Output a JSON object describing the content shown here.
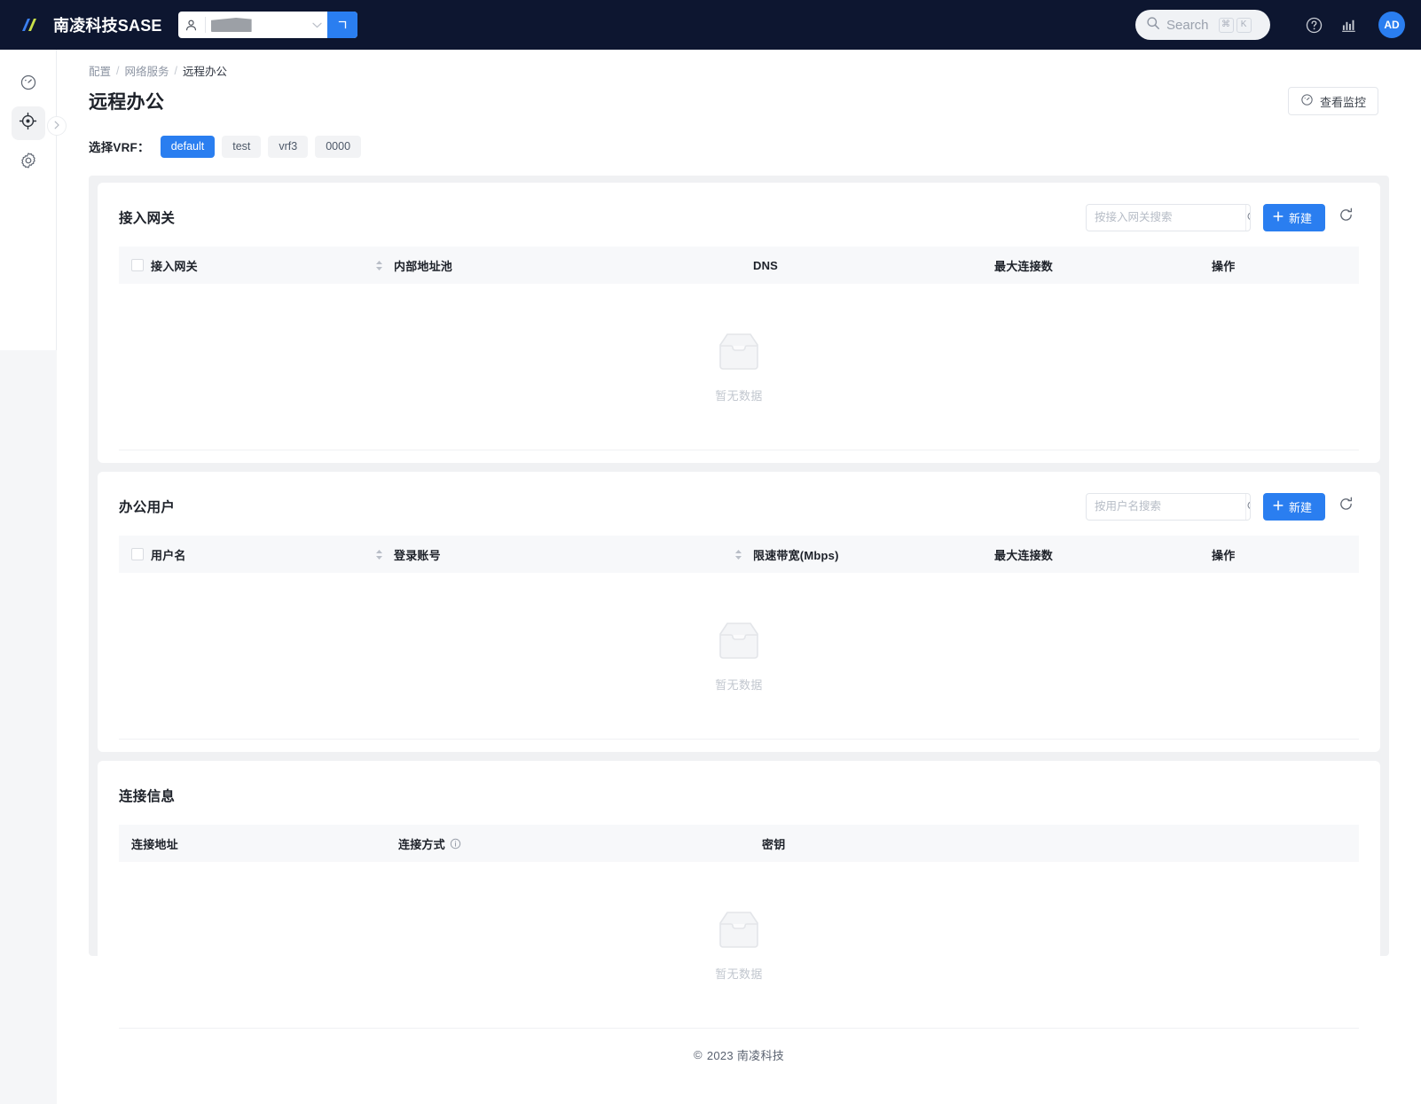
{
  "topbar": {
    "brand": "南凌科技SASE",
    "tenant_caret": "chevron-down",
    "search_placeholder": "Search",
    "search_key_cmd": "⌘",
    "search_key_letter": "K",
    "avatar_initials": "AD"
  },
  "sidebar": {
    "items": [
      {
        "name": "dashboard",
        "icon": "gauge-icon",
        "active": false
      },
      {
        "name": "network",
        "icon": "target-icon",
        "active": true
      },
      {
        "name": "settings",
        "icon": "gear-icon",
        "active": false
      }
    ]
  },
  "breadcrumb": {
    "items": [
      "配置",
      "网络服务",
      "远程办公"
    ],
    "separator": "/"
  },
  "page": {
    "title": "远程办公",
    "monitor_button": "查看监控"
  },
  "vrf": {
    "label": "选择VRF：",
    "options": [
      "default",
      "test",
      "vrf3",
      "0000"
    ],
    "selected": "default"
  },
  "cards": [
    {
      "title": "接入网关",
      "search_placeholder": "按接入网关搜索",
      "new_label": "新建",
      "columns": [
        {
          "label": "接入网关",
          "checkbox": true,
          "sortable": true
        },
        {
          "label": "内部地址池",
          "checkbox": false,
          "sortable": false
        },
        {
          "label": "DNS",
          "checkbox": false,
          "sortable": false
        },
        {
          "label": "最大连接数",
          "checkbox": false,
          "sortable": false
        },
        {
          "label": "操作",
          "checkbox": false,
          "sortable": false
        }
      ],
      "rows": [],
      "empty_text": "暂无数据"
    },
    {
      "title": "办公用户",
      "search_placeholder": "按用户名搜索",
      "new_label": "新建",
      "columns": [
        {
          "label": "用户名",
          "checkbox": true,
          "sortable": true
        },
        {
          "label": "登录账号",
          "checkbox": false,
          "sortable": true
        },
        {
          "label": "限速带宽(Mbps)",
          "checkbox": false,
          "sortable": false
        },
        {
          "label": "最大连接数",
          "checkbox": false,
          "sortable": false
        },
        {
          "label": "操作",
          "checkbox": false,
          "sortable": false
        }
      ],
      "rows": [],
      "empty_text": "暂无数据"
    },
    {
      "title": "连接信息",
      "search_placeholder": null,
      "new_label": null,
      "columns": [
        {
          "label": "连接地址",
          "checkbox": false,
          "sortable": false
        },
        {
          "label": "连接方式",
          "checkbox": false,
          "sortable": false,
          "info": true
        },
        {
          "label": "密钥",
          "checkbox": false,
          "sortable": false
        }
      ],
      "rows": [],
      "empty_text": "暂无数据"
    }
  ],
  "footer": {
    "copyright_mark": "©",
    "text": "2023 南凌科技"
  },
  "colors": {
    "brand_navy": "#0d1630",
    "accent_blue": "#2a7ef0",
    "page_bg": "#f0f1f3",
    "text_primary": "#1d2129",
    "text_muted": "#8d95a3"
  }
}
